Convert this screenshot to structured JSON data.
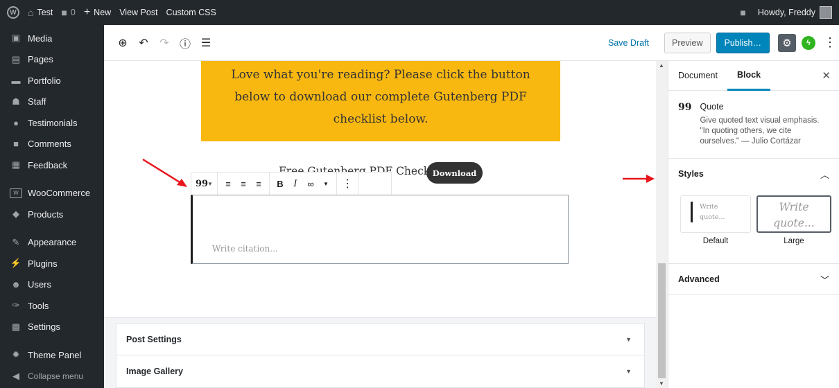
{
  "admin_bar": {
    "site_name": "Test",
    "comment_count": "0",
    "new_label": "New",
    "view_post": "View Post",
    "custom_css": "Custom CSS",
    "greeting": "Howdy, Freddy"
  },
  "sidebar": {
    "items": [
      {
        "label": "Media",
        "icon": "media-icon"
      },
      {
        "label": "Pages",
        "icon": "pages-icon"
      },
      {
        "label": "Portfolio",
        "icon": "portfolio-icon"
      },
      {
        "label": "Staff",
        "icon": "staff-icon"
      },
      {
        "label": "Testimonials",
        "icon": "testimonials-icon"
      },
      {
        "label": "Comments",
        "icon": "comments-icon"
      },
      {
        "label": "Feedback",
        "icon": "feedback-icon"
      },
      {
        "label": "WooCommerce",
        "icon": "woocommerce-icon"
      },
      {
        "label": "Products",
        "icon": "products-icon"
      },
      {
        "label": "Appearance",
        "icon": "appearance-icon"
      },
      {
        "label": "Plugins",
        "icon": "plugins-icon"
      },
      {
        "label": "Users",
        "icon": "users-icon"
      },
      {
        "label": "Tools",
        "icon": "tools-icon"
      },
      {
        "label": "Settings",
        "icon": "settings-icon"
      },
      {
        "label": "Theme Panel",
        "icon": "theme-panel-icon"
      }
    ],
    "collapse_label": "Collapse menu"
  },
  "header": {
    "save_draft": "Save Draft",
    "preview": "Preview",
    "publish": "Publish…"
  },
  "content": {
    "cta_text": "Love what you're reading? Please click the button below to download our complete Gutenberg PDF checklist below.",
    "checklist_text": "Free Gutenberg PDF Checklist",
    "download_label": "Download",
    "citation_placeholder": "Write citation..."
  },
  "meta_boxes": {
    "post_settings": "Post Settings",
    "image_gallery": "Image Gallery"
  },
  "inspector": {
    "tab_document": "Document",
    "tab_block": "Block",
    "block_title": "Quote",
    "block_description": "Give quoted text visual emphasis. \"In quoting others, we cite ourselves.\" — Julio Cortázar",
    "styles_heading": "Styles",
    "style_default_preview": "Write quote...",
    "style_default_label": "Default",
    "style_large_preview": "Write quote...",
    "style_large_label": "Large",
    "advanced_heading": "Advanced"
  },
  "colors": {
    "admin_bg": "#23282d",
    "accent": "#0085ba",
    "cta_bg": "#f9b810",
    "arrow": "#e8141b"
  }
}
